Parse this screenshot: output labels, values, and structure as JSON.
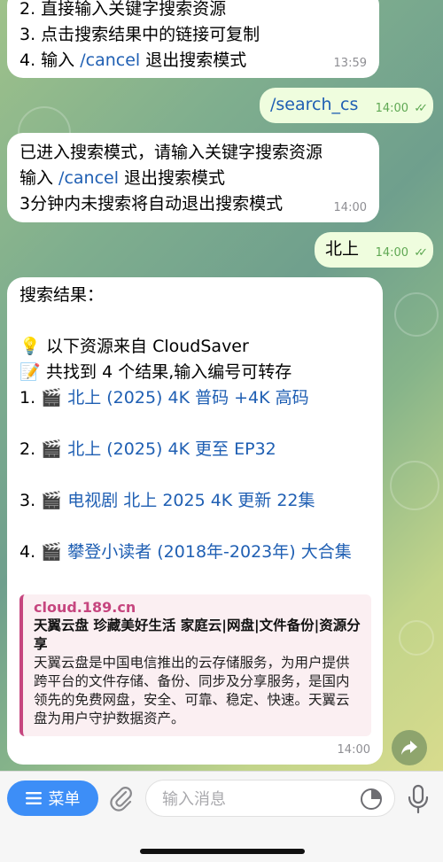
{
  "messages": {
    "m1": {
      "line2": "2. 直接输入关键字搜索资源",
      "line3": "3. 点击搜索结果中的链接可复制",
      "line4_pre": "4. 输入 ",
      "line4_cmd": "/cancel",
      "line4_post": " 退出搜索模式",
      "time": "13:59"
    },
    "m2": {
      "text": "/search_cs",
      "time": "14:00"
    },
    "m3": {
      "line1": "已进入搜索模式，请输入关键字搜索资源",
      "line2_pre": "输入 ",
      "line2_cmd": "/cancel",
      "line2_post": " 退出搜索模式",
      "line3": "3分钟内未搜索将自动退出搜索模式",
      "time": "14:00"
    },
    "m4": {
      "text": "北上",
      "time": "14:00"
    },
    "m5": {
      "header": "搜索结果：",
      "info1": "以下资源来自 CloudSaver",
      "info2": "共找到 4 个结果,输入编号可转存",
      "results": [
        {
          "num": "1.",
          "title": "北上 (2025) 4K 普码 +4K 高码"
        },
        {
          "num": "2.",
          "title": "北上 (2025) 4K 更至 EP32"
        },
        {
          "num": "3.",
          "title": "电视剧 北上 2025 4K 更新 22集"
        },
        {
          "num": "4.",
          "title": "攀登小读者 (2018年-2023年) 大合集"
        }
      ],
      "preview": {
        "site": "cloud.189.cn",
        "title": "天翼云盘 珍藏美好生活 家庭云|网盘|文件备份|资源分享",
        "desc": "天翼云盘是中国电信推出的云存储服务，为用户提供跨平台的文件存储、备份、同步及分享服务，是国内领先的免费网盘，安全、可靠、稳定、快速。天翼云盘为用户守护数据资产。"
      },
      "time": "14:00"
    }
  },
  "input_bar": {
    "menu_label": "菜单",
    "placeholder": "输入消息"
  },
  "icons": {
    "bulb": "💡",
    "memo": "📝",
    "clapper": "🎬",
    "read_checks": "✓✓"
  },
  "colors": {
    "accent": "#3d8ef7",
    "link": "#1f5fb3",
    "outgoing_bubble": "#effdde",
    "preview_accent": "#c6467f"
  }
}
